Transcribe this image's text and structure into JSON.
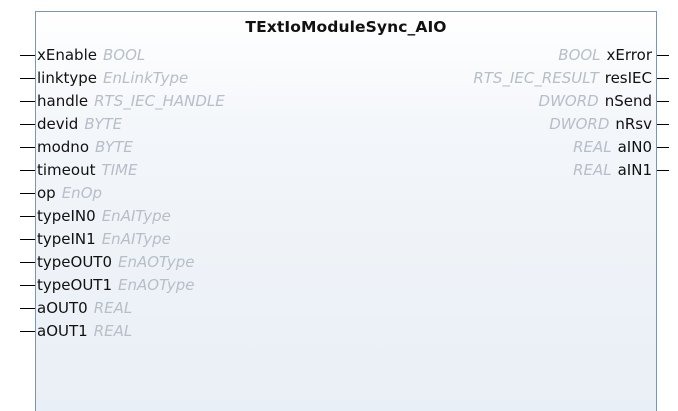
{
  "block": {
    "title": "TExtIoModuleSync_AIO",
    "inputs": [
      {
        "name": "xEnable",
        "type": "BOOL"
      },
      {
        "name": "linktype",
        "type": "EnLinkType"
      },
      {
        "name": "handle",
        "type": "RTS_IEC_HANDLE"
      },
      {
        "name": "devid",
        "type": "BYTE"
      },
      {
        "name": "modno",
        "type": "BYTE"
      },
      {
        "name": "timeout",
        "type": "TIME"
      },
      {
        "name": "op",
        "type": "EnOp"
      },
      {
        "name": "typeIN0",
        "type": "EnAIType"
      },
      {
        "name": "typeIN1",
        "type": "EnAIType"
      },
      {
        "name": "typeOUT0",
        "type": "EnAOType"
      },
      {
        "name": "typeOUT1",
        "type": "EnAOType"
      },
      {
        "name": "aOUT0",
        "type": "REAL"
      },
      {
        "name": "aOUT1",
        "type": "REAL"
      }
    ],
    "outputs": [
      {
        "name": "xError",
        "type": "BOOL"
      },
      {
        "name": "resIEC",
        "type": "RTS_IEC_RESULT"
      },
      {
        "name": "nSend",
        "type": "DWORD"
      },
      {
        "name": "nRsv",
        "type": "DWORD"
      },
      {
        "name": "aIN0",
        "type": "REAL"
      },
      {
        "name": "aIN1",
        "type": "REAL"
      }
    ]
  }
}
